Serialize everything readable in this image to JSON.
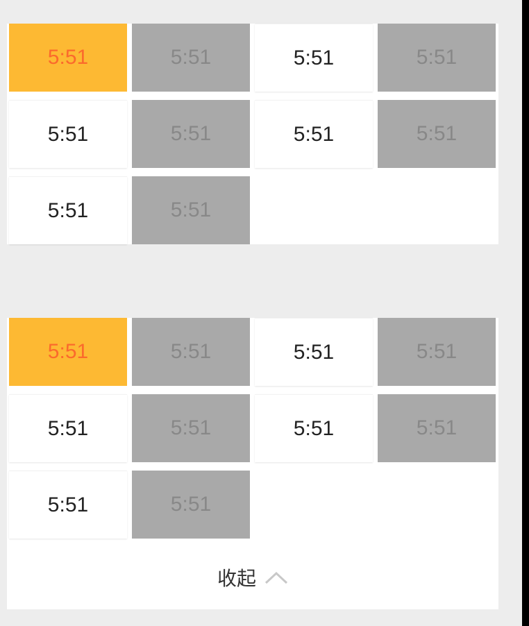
{
  "top_grid": {
    "slots": [
      {
        "time": "5:51",
        "state": "selected"
      },
      {
        "time": "5:51",
        "state": "disabled"
      },
      {
        "time": "5:51",
        "state": "available"
      },
      {
        "time": "5:51",
        "state": "disabled"
      },
      {
        "time": "5:51",
        "state": "available"
      },
      {
        "time": "5:51",
        "state": "disabled"
      },
      {
        "time": "5:51",
        "state": "available"
      },
      {
        "time": "5:51",
        "state": "disabled"
      },
      {
        "time": "5:51",
        "state": "available"
      },
      {
        "time": "5:51",
        "state": "disabled"
      }
    ]
  },
  "bottom_grid": {
    "slots": [
      {
        "time": "5:51",
        "state": "selected"
      },
      {
        "time": "5:51",
        "state": "disabled"
      },
      {
        "time": "5:51",
        "state": "available"
      },
      {
        "time": "5:51",
        "state": "disabled"
      },
      {
        "time": "5:51",
        "state": "available"
      },
      {
        "time": "5:51",
        "state": "disabled"
      },
      {
        "time": "5:51",
        "state": "available"
      },
      {
        "time": "5:51",
        "state": "disabled"
      },
      {
        "time": "5:51",
        "state": "available"
      },
      {
        "time": "5:51",
        "state": "disabled"
      }
    ],
    "collapse_label": "收起",
    "collapse_icon": "chevron-up-icon"
  },
  "colors": {
    "selected_bg": "#fdb933",
    "selected_text": "#fb6a2c",
    "disabled_bg": "#a9a9a9",
    "disabled_text": "#888888",
    "available_text": "#222222",
    "page_bg": "#ededed"
  }
}
